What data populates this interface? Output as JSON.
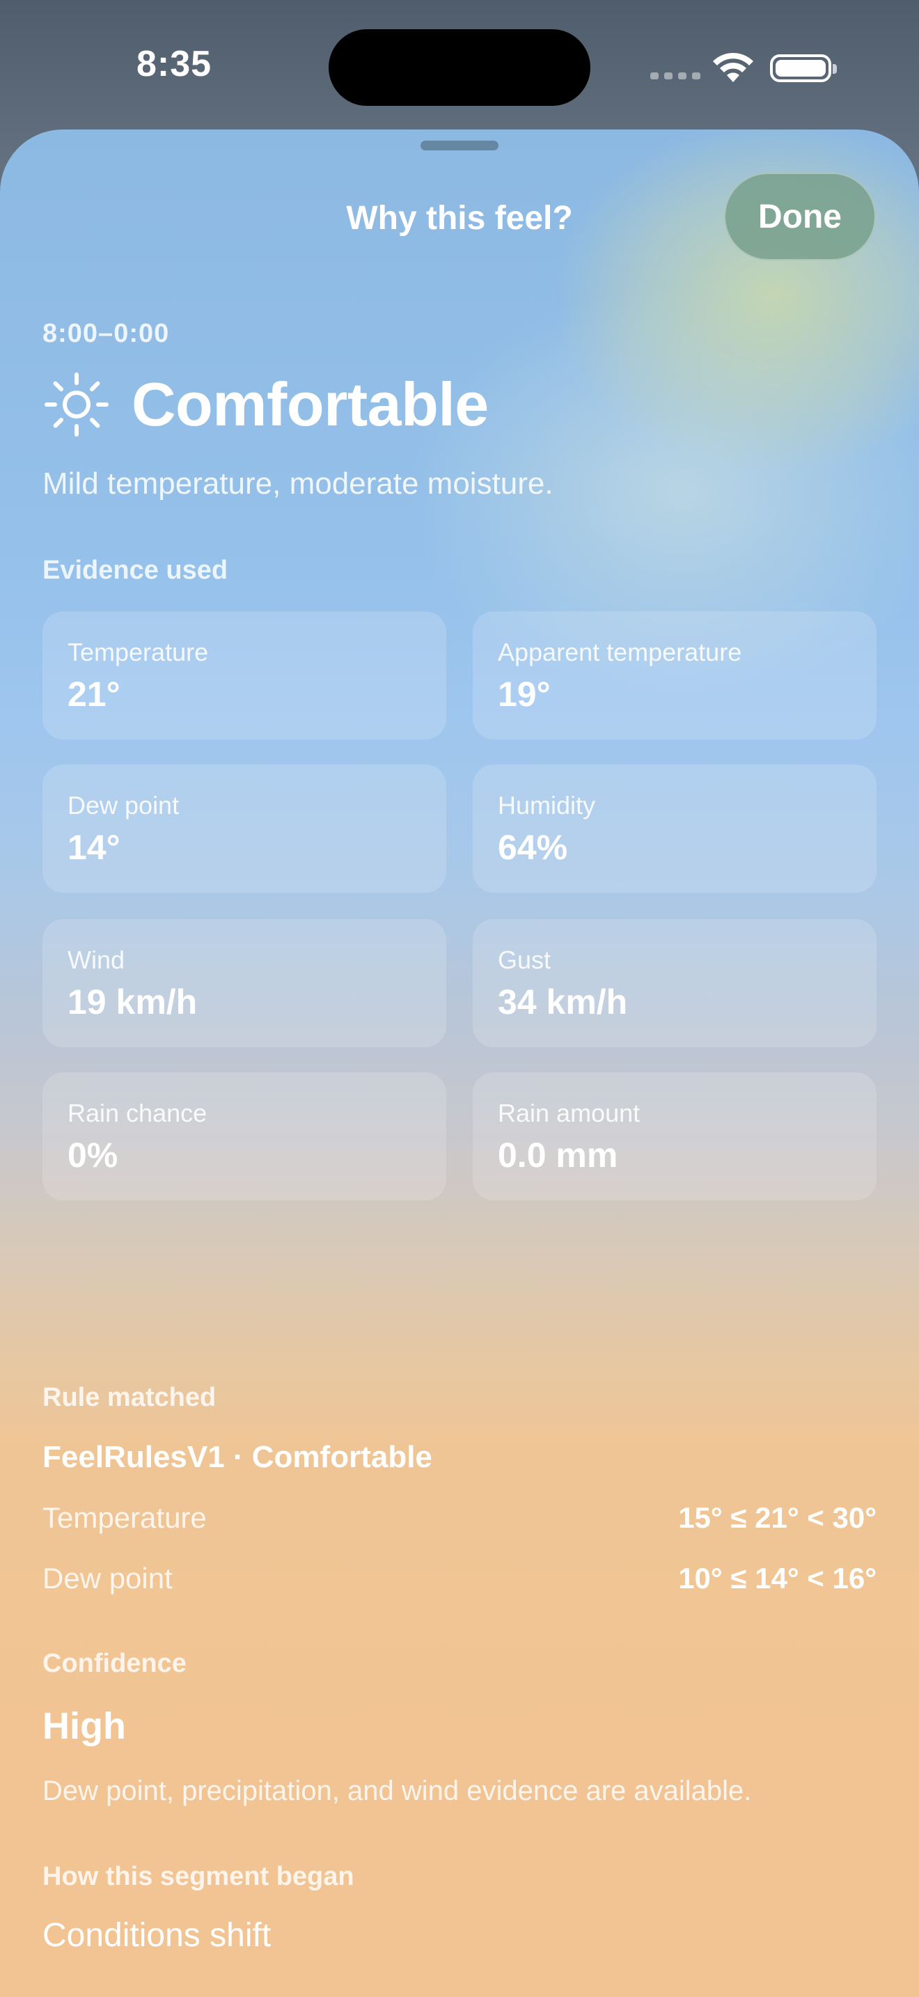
{
  "status_bar": {
    "time": "8:35",
    "icons": [
      "cellular-signal-icon",
      "wifi-icon",
      "battery-icon"
    ]
  },
  "sheet": {
    "title": "Why this feel?",
    "done_label": "Done"
  },
  "feel": {
    "time_range": "8:00–0:00",
    "icon": "sun-icon",
    "name": "Comfortable",
    "description": "Mild temperature, moderate moisture."
  },
  "evidence": {
    "label": "Evidence used",
    "items": [
      {
        "label": "Temperature",
        "value": "21°"
      },
      {
        "label": "Apparent temperature",
        "value": "19°"
      },
      {
        "label": "Dew point",
        "value": "14°"
      },
      {
        "label": "Humidity",
        "value": "64%"
      },
      {
        "label": "Wind",
        "value": "19 km/h"
      },
      {
        "label": "Gust",
        "value": "34 km/h"
      },
      {
        "label": "Rain chance",
        "value": "0%"
      },
      {
        "label": "Rain amount",
        "value": "0.0 mm"
      }
    ]
  },
  "rule": {
    "label": "Rule matched",
    "name": "FeelRulesV1 · Comfortable",
    "conditions": [
      {
        "key": "Temperature",
        "value": "15° ≤ 21° < 30°"
      },
      {
        "key": "Dew point",
        "value": "10° ≤ 14° < 16°"
      }
    ]
  },
  "confidence": {
    "label": "Confidence",
    "value": "High",
    "note": "Dew point, precipitation, and wind evidence are available."
  },
  "segment": {
    "label": "How this segment began",
    "value": "Conditions shift"
  },
  "colors": {
    "sheet_top": "#8cb9e2",
    "sheet_bottom": "#f3c493",
    "done_button": "#78a08c"
  }
}
